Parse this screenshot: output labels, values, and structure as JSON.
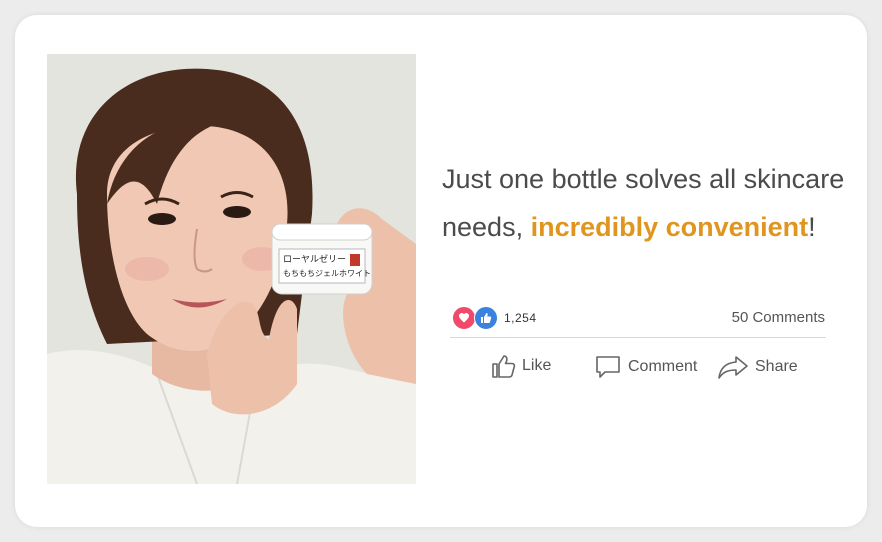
{
  "post": {
    "headline_pre": "Just one bottle solves all skincare needs, ",
    "headline_highlight": "incredibly convenient",
    "headline_post": "!",
    "highlight_color": "#e0951e"
  },
  "stats": {
    "reaction_count": "1,254",
    "comments_label": "50 Comments",
    "reaction_icons": [
      "heart-icon",
      "thumbs-up-icon"
    ]
  },
  "actions": {
    "like_label": "Like",
    "comment_label": "Comment",
    "share_label": "Share"
  },
  "product": {
    "jar_label_line1": "ローヤルゼリー",
    "jar_label_line2": "もちもちジェルホワイト"
  }
}
